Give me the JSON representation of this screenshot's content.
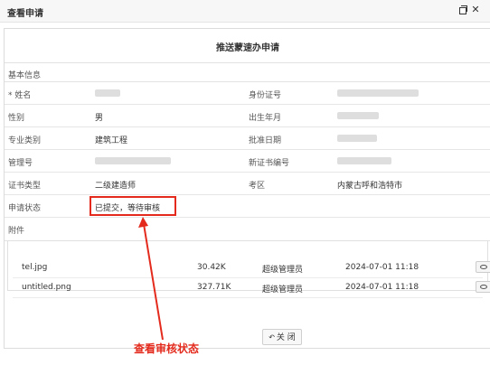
{
  "window": {
    "title": "查看申请"
  },
  "form": {
    "title": "推送蒙速办申请"
  },
  "sections": {
    "basic": "基本信息",
    "attachments": "附件"
  },
  "fields": {
    "name_label": "* 姓名",
    "idcard_label": "身份证号",
    "gender_label": "性别",
    "gender_value": "男",
    "birth_label": "出生年月",
    "major_label": "专业类别",
    "major_value": "建筑工程",
    "approval_date_label": "批准日期",
    "mgmt_no_label": "管理号",
    "new_cert_no_label": "新证书编号",
    "cert_type_label": "证书类型",
    "cert_type_value": "二级建造师",
    "exam_area_label": "考区",
    "exam_area_value": "内蒙古呼和浩特市",
    "status_label": "申请状态",
    "status_value": "已提交，等待审核"
  },
  "attachments": [
    {
      "name": "tel.jpg",
      "size": "30.42K",
      "uploader": "超级管理员",
      "time": "2024-07-01 11:18"
    },
    {
      "name": "untitled.png",
      "size": "327.71K",
      "uploader": "超级管理员",
      "time": "2024-07-01 11:18"
    }
  ],
  "footer": {
    "close_label": "关 闭"
  },
  "annotation": {
    "text": "查看审核状态",
    "color": "#e32a1c"
  },
  "icons": [
    "maximize-icon",
    "close-icon",
    "eye-icon",
    "undo-icon"
  ]
}
